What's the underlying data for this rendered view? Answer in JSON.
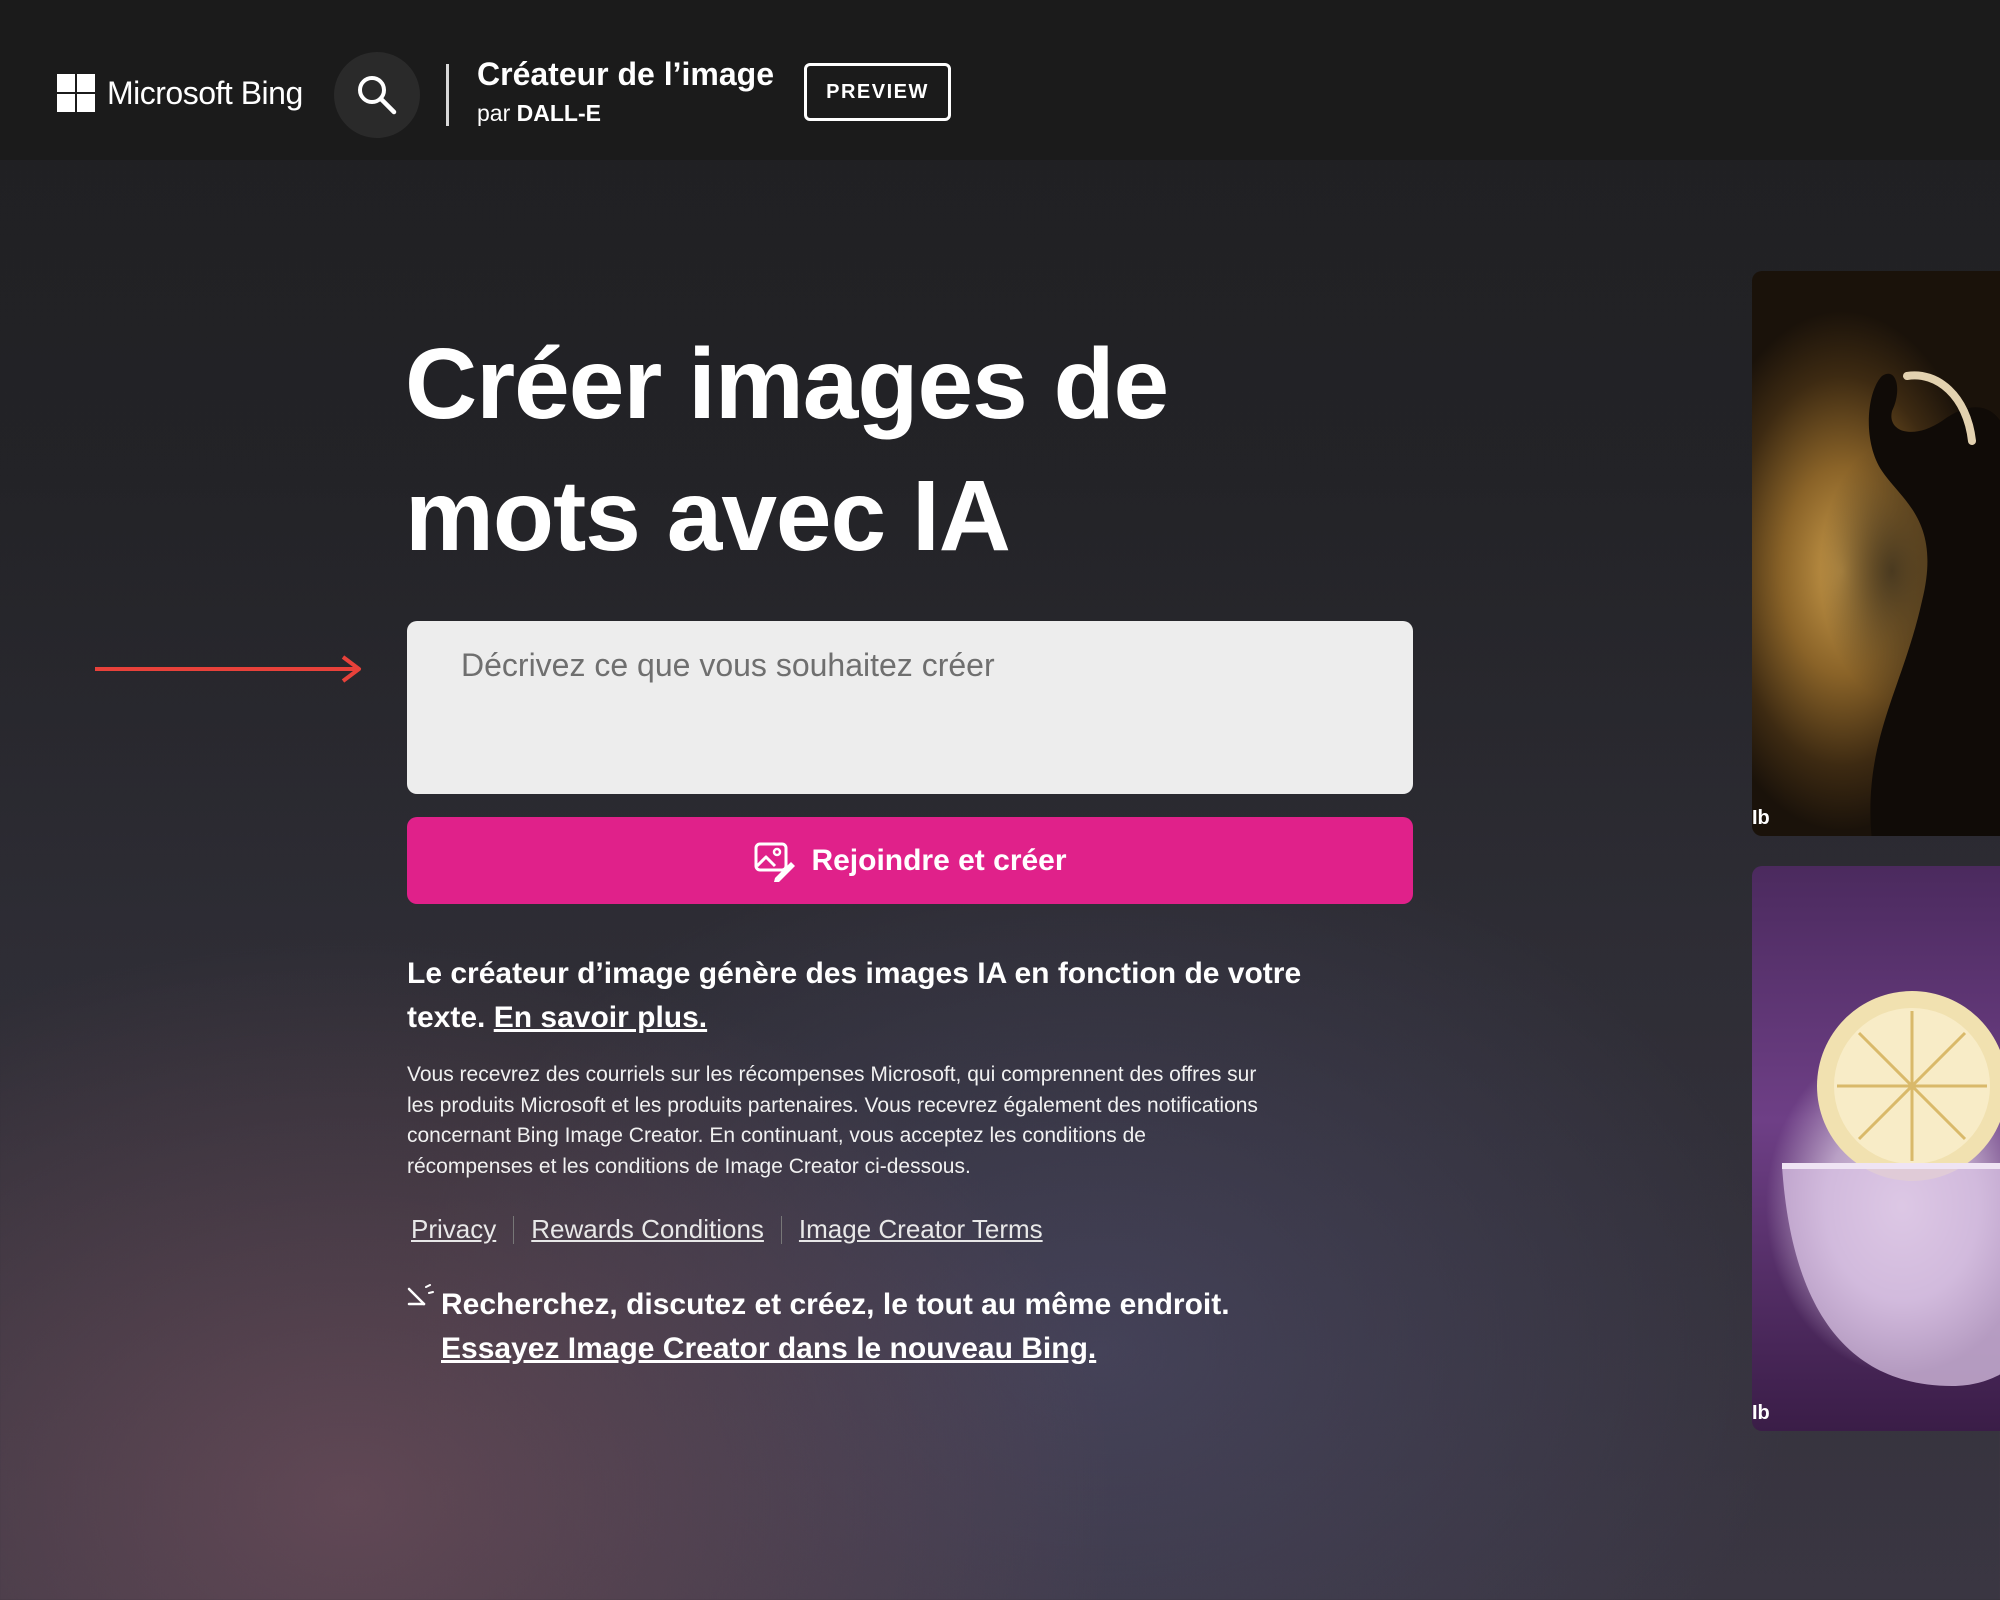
{
  "header": {
    "brand_name": "Microsoft Bing",
    "product_title": "Créateur de l’image",
    "product_by": "par ",
    "product_engine": "DALL-E",
    "preview_badge": "PREVIEW"
  },
  "main": {
    "hero_title": "Créer images de mots avec IA",
    "prompt_placeholder": "Décrivez ce que vous souhaitez créer",
    "prompt_value": "",
    "create_button_label": "Rejoindre et créer",
    "description_text": "Le créateur d’image génère des images IA en fonction de votre texte. ",
    "description_link": "En savoir plus.",
    "legal_text": "Vous recevrez des courriels sur les récompenses Microsoft, qui comprennent des offres sur les produits Microsoft et les produits partenaires. Vous recevrez également des notifications concernant Bing Image Creator. En continuant, vous acceptez les conditions de récompenses et les conditions de Image Creator ci-dessous.",
    "links": [
      "Privacy",
      "Rewards Conditions",
      "Image Creator Terms"
    ],
    "try_text": "Recherchez, discutez et créez, le tout au même endroit.",
    "try_link": "Essayez Image Creator dans le nouveau Bing."
  },
  "gallery": {
    "thumb_mark": "Ib",
    "images": [
      "elephant-portrait-image",
      "lemon-cocktail-image"
    ]
  },
  "colors": {
    "accent": "#e0218a",
    "header_bg": "#1b1b1b",
    "annotation_arrow": "#e8413a"
  },
  "icons": [
    "microsoft-logo-icon",
    "search-icon",
    "image-create-icon",
    "new-bing-icon",
    "red-arrow-annotation"
  ]
}
